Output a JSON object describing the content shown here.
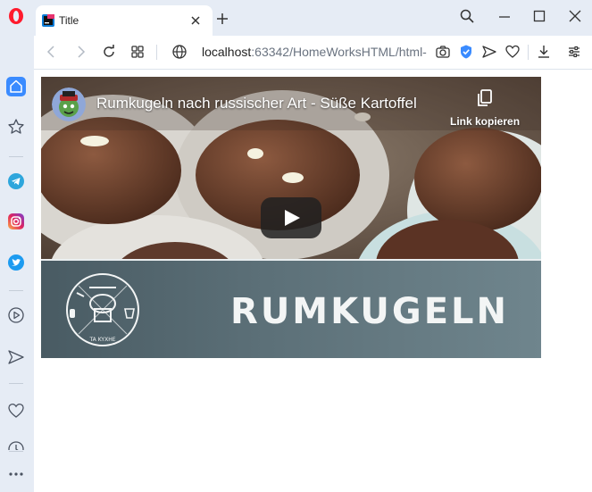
{
  "browser": {
    "tab": {
      "title": "Title"
    },
    "address": {
      "url_host": "localhost",
      "url_rest": ":63342/HomeWorksHTML/html-"
    }
  },
  "sidebar": {
    "items": [
      "home-icon",
      "star-icon",
      "telegram-icon",
      "instagram-icon",
      "twitter-icon",
      "player-icon",
      "send-icon",
      "heart-icon",
      "history-icon",
      "more-icon"
    ]
  },
  "video": {
    "title": "Rumkugeln nach russischer Art - Süße Kartoffel",
    "copy_link_label": "Link kopieren",
    "banner_text": "RUMKUGELN",
    "logo_caption": "TA KYXHE"
  },
  "colors": {
    "accent": "#3a8bff",
    "opera_red": "#ff1b2d",
    "chrome_bg": "#e6ecf5"
  }
}
